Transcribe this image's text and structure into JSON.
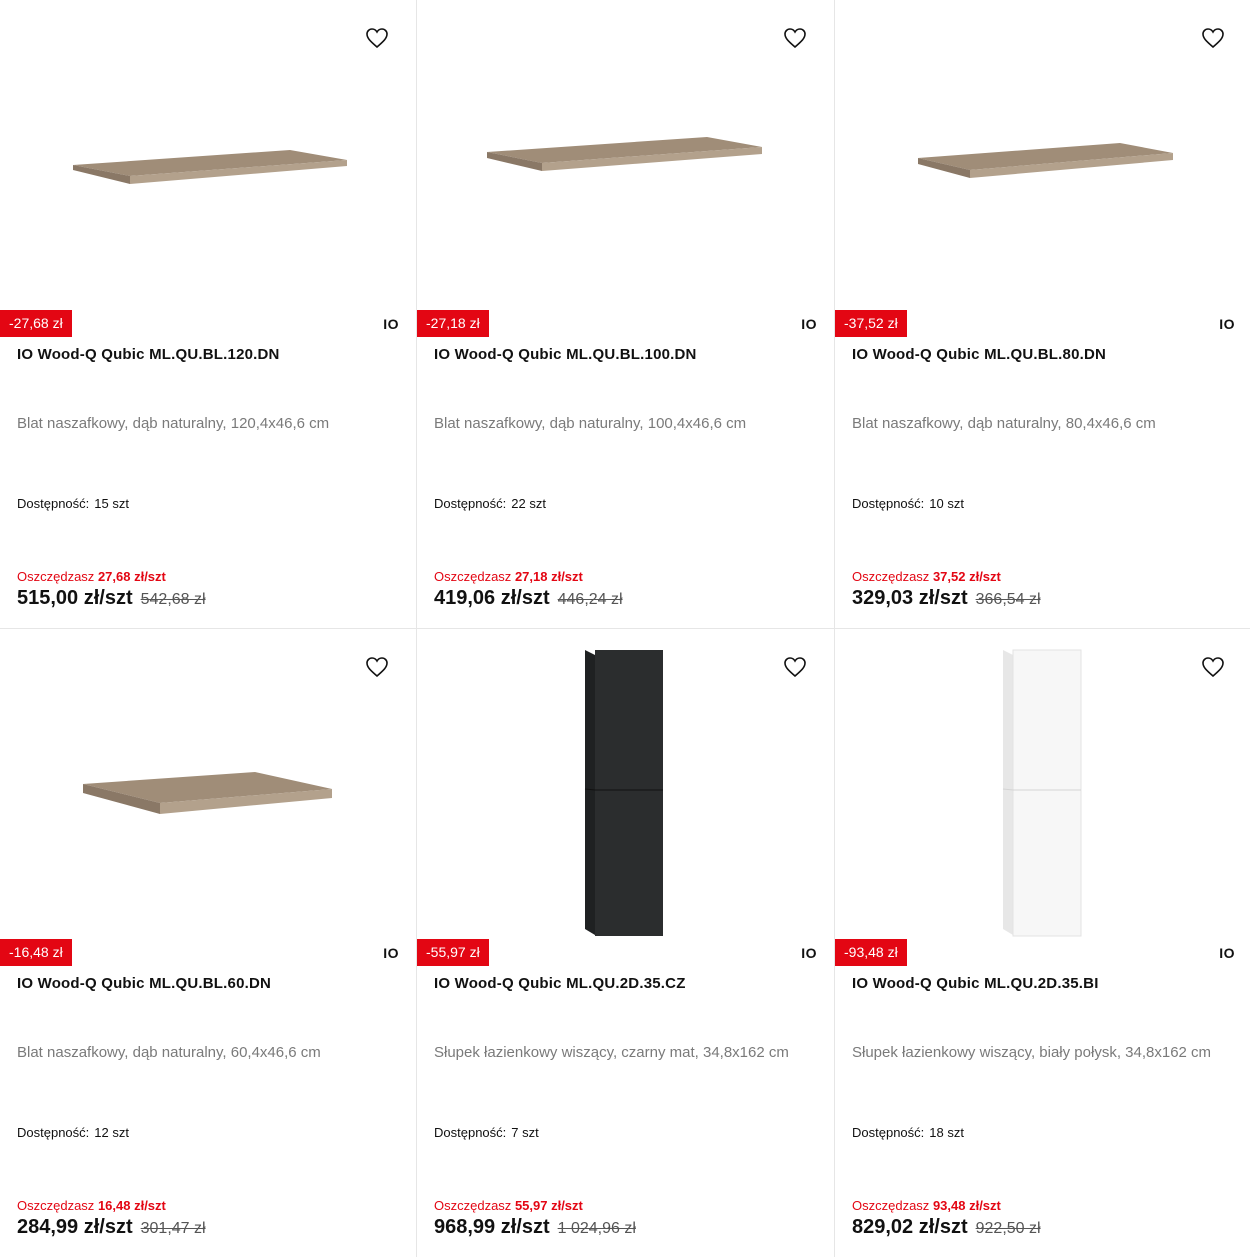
{
  "products": [
    {
      "discount_badge": "-27,68 zł",
      "brand": "IO",
      "name": "IO Wood-Q Qubic ML.QU.BL.120.DN",
      "description": "Blat naszafkowy, dąb naturalny, 120,4x46,6 cm",
      "availability_label": "Dostępność:",
      "availability_value": "15 szt",
      "save_label": "Oszczędzasz",
      "save_value": "27,68 zł/szt",
      "price": "515,00 zł/szt",
      "old_price": "542,68 zł",
      "image_icon": "wooden-countertop",
      "wishlist_icon": "heart-icon"
    },
    {
      "discount_badge": "-27,18 zł",
      "brand": "IO",
      "name": "IO Wood-Q Qubic ML.QU.BL.100.DN",
      "description": "Blat naszafkowy, dąb naturalny, 100,4x46,6 cm",
      "availability_label": "Dostępność:",
      "availability_value": "22 szt",
      "save_label": "Oszczędzasz",
      "save_value": "27,18 zł/szt",
      "price": "419,06 zł/szt",
      "old_price": "446,24 zł",
      "image_icon": "wooden-countertop",
      "wishlist_icon": "heart-icon"
    },
    {
      "discount_badge": "-37,52 zł",
      "brand": "IO",
      "name": "IO Wood-Q Qubic ML.QU.BL.80.DN",
      "description": "Blat naszafkowy, dąb naturalny, 80,4x46,6 cm",
      "availability_label": "Dostępność:",
      "availability_value": "10 szt",
      "save_label": "Oszczędzasz",
      "save_value": "37,52 zł/szt",
      "price": "329,03 zł/szt",
      "old_price": "366,54 zł",
      "image_icon": "wooden-countertop",
      "wishlist_icon": "heart-icon"
    },
    {
      "discount_badge": "-16,48 zł",
      "brand": "IO",
      "name": "IO Wood-Q Qubic ML.QU.BL.60.DN",
      "description": "Blat naszafkowy, dąb naturalny, 60,4x46,6 cm",
      "availability_label": "Dostępność:",
      "availability_value": "12 szt",
      "save_label": "Oszczędzasz",
      "save_value": "16,48 zł/szt",
      "price": "284,99 zł/szt",
      "old_price": "301,47 zł",
      "image_icon": "wooden-countertop",
      "wishlist_icon": "heart-icon"
    },
    {
      "discount_badge": "-55,97 zł",
      "brand": "IO",
      "name": "IO Wood-Q Qubic ML.QU.2D.35.CZ",
      "description": "Słupek łazienkowy wiszący, czarny mat, 34,8x162 cm",
      "availability_label": "Dostępność:",
      "availability_value": "7 szt",
      "save_label": "Oszczędzasz",
      "save_value": "55,97 zł/szt",
      "price": "968,99 zł/szt",
      "old_price": "1 024,96 zł",
      "image_icon": "tall-cabinet-black",
      "wishlist_icon": "heart-icon"
    },
    {
      "discount_badge": "-93,48 zł",
      "brand": "IO",
      "name": "IO Wood-Q Qubic ML.QU.2D.35.BI",
      "description": "Słupek łazienkowy wiszący, biały połysk, 34,8x162 cm",
      "availability_label": "Dostępność:",
      "availability_value": "18 szt",
      "save_label": "Oszczędzasz",
      "save_value": "93,48 zł/szt",
      "price": "829,02 zł/szt",
      "old_price": "922,50 zł",
      "image_icon": "tall-cabinet-white",
      "wishlist_icon": "heart-icon"
    }
  ],
  "colors": {
    "accent_red": "#e30613",
    "wood_top": "#a08d78",
    "wood_edge": "#8a7866",
    "cabinet_black": "#2b2d2e",
    "cabinet_white": "#f7f7f7"
  }
}
